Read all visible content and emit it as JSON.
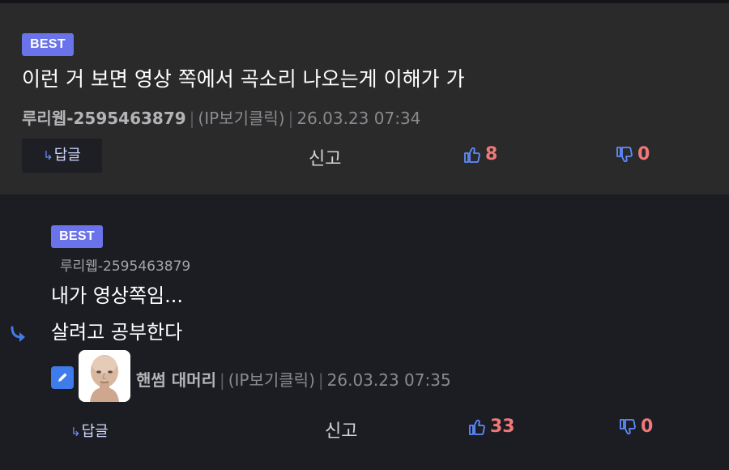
{
  "comment1": {
    "badge": "BEST",
    "text": "이런 거 보면 영상 쪽에서 곡소리 나오는게 이해가 가",
    "author": "루리웹-2595463879",
    "ip": "(IP보기클릭)",
    "timestamp": "26.03.23 07:34",
    "reply_label": "답글",
    "report_label": "신고",
    "upvotes": "8",
    "downvotes": "0"
  },
  "comment2": {
    "badge": "BEST",
    "parent_author": "루리웹-2595463879",
    "line1": "내가 영상쪽임...",
    "line2": "살려고 공부한다",
    "author": "핸썸 대머리",
    "ip": "(IP보기클릭)",
    "timestamp": "26.03.23 07:35",
    "reply_label": "답글",
    "report_label": "신고",
    "upvotes": "33",
    "downvotes": "0"
  },
  "separator": "|",
  "colors": {
    "badge": "#6a73ea",
    "vote": "#f07878",
    "thumb_icon": "#5f8cff",
    "background_dark": "#1c1d23",
    "background_comment": "#2a2a2b"
  },
  "icons": {
    "reply_arrow": "↳",
    "thumb_up": "thumbs-up-icon",
    "thumb_down": "thumbs-down-icon",
    "edit": "pencil-icon",
    "nested_reply": "reply-arrow-icon"
  }
}
